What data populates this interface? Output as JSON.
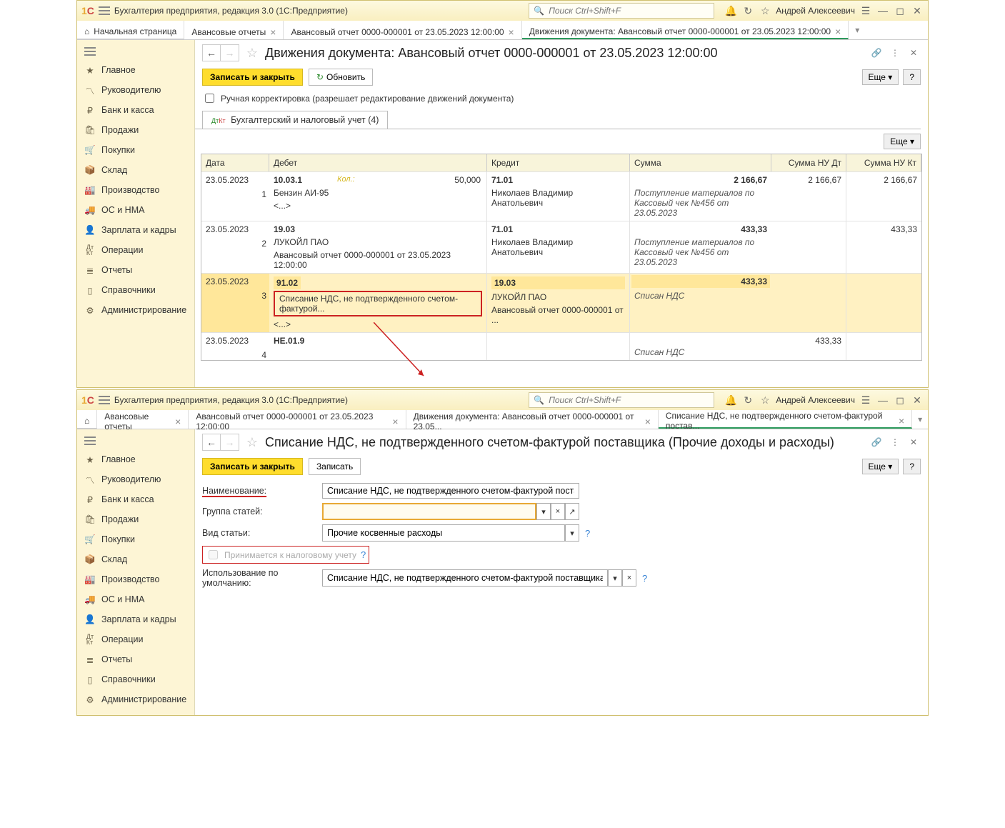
{
  "app_title": "Бухгалтерия предприятия, редакция 3.0  (1С:Предприятие)",
  "search_placeholder": "Поиск Ctrl+Shift+F",
  "user_name": "Андрей Алексеевич",
  "sidebar": [
    {
      "label": "Главное"
    },
    {
      "label": "Руководителю"
    },
    {
      "label": "Банк и касса"
    },
    {
      "label": "Продажи"
    },
    {
      "label": "Покупки"
    },
    {
      "label": "Склад"
    },
    {
      "label": "Производство"
    },
    {
      "label": "ОС и НМА"
    },
    {
      "label": "Зарплата и кадры"
    },
    {
      "label": "Операции"
    },
    {
      "label": "Отчеты"
    },
    {
      "label": "Справочники"
    },
    {
      "label": "Администрирование"
    }
  ],
  "top_window": {
    "tabs": {
      "home": "Начальная страница",
      "t1": "Авансовые отчеты",
      "t2": "Авансовый отчет 0000-000001 от 23.05.2023 12:00:00",
      "t3": "Движения документа: Авансовый отчет 0000-000001 от 23.05.2023 12:00:00"
    },
    "page_title": "Движения документа: Авансовый отчет 0000-000001 от 23.05.2023 12:00:00",
    "save_close": "Записать и закрыть",
    "refresh": "Обновить",
    "more": "Еще",
    "help": "?",
    "manual_corr": "Ручная корректировка (разрешает редактирование движений документа)",
    "doc_tab": "Бухгалтерский и налоговый учет (4)",
    "columns": {
      "date": "Дата",
      "debit": "Дебет",
      "credit": "Кредит",
      "sum": "Сумма",
      "nud": "Сумма НУ Дт",
      "nuk": "Сумма НУ Кт"
    },
    "rows": [
      {
        "n": "1",
        "date": "23.05.2023",
        "debit_acc": "10.03.1",
        "kol_lbl": "Кол.:",
        "kol_val": "50,000",
        "debit_l2": "Бензин АИ-95",
        "debit_l3": "<...>",
        "credit_acc": "71.01",
        "credit_l2": "Николаев Владимир Анатольевич",
        "sum": "2 166,67",
        "desc1": "Поступление материалов по",
        "desc2": "Кассовый чек №456 от",
        "desc3": "23.05.2023",
        "nud": "2 166,67",
        "nuk": "2 166,67"
      },
      {
        "n": "2",
        "date": "23.05.2023",
        "debit_acc": "19.03",
        "debit_l2": "ЛУКОЙЛ ПАО",
        "debit_l3": "Авансовый отчет 0000-000001 от 23.05.2023 12:00:00",
        "credit_acc": "71.01",
        "credit_l2": "Николаев Владимир Анатольевич",
        "sum": "433,33",
        "desc1": "Поступление материалов по",
        "desc2": "Кассовый чек №456 от",
        "desc3": "23.05.2023",
        "nud": "",
        "nuk": "433,33"
      },
      {
        "n": "3",
        "date": "23.05.2023",
        "debit_acc": "91.02",
        "debit_l2": "Списание НДС, не подтвержденного счетом-фактурой...",
        "debit_l3": "<...>",
        "credit_acc": "19.03",
        "credit_l2": "ЛУКОЙЛ ПАО",
        "credit_l3": "Авансовый отчет 0000-000001 от ...",
        "sum": "433,33",
        "desc": "Списан НДС",
        "nud": "",
        "nuk": ""
      },
      {
        "n": "4",
        "date": "23.05.2023",
        "debit_acc": "НЕ.01.9",
        "sum": "",
        "desc": "Списан НДС",
        "nud": "433,33",
        "nuk": ""
      }
    ]
  },
  "bottom_window": {
    "tabs": {
      "t1": "Авансовые отчеты",
      "t2": "Авансовый отчет 0000-000001 от 23.05.2023 12:00:00",
      "t3": "Движения документа: Авансовый отчет 0000-000001 от 23.05...",
      "t4": "Списание НДС, не подтвержденного счетом-фактурой постав..."
    },
    "page_title": "Списание НДС, не подтвержденного счетом-фактурой поставщика (Прочие доходы и расходы)",
    "save_close": "Записать и закрыть",
    "save": "Записать",
    "more": "Еще",
    "help": "?",
    "labels": {
      "name": "Наименование:",
      "group": "Группа статей:",
      "kind": "Вид статьи:",
      "tax": "Принимается к налоговому учету",
      "default": "Использование по умолчанию:"
    },
    "values": {
      "name": "Списание НДС, не подтвержденного счетом-фактурой поставщика",
      "group": "",
      "kind": "Прочие косвенные расходы",
      "default": "Списание НДС, не подтвержденного счетом-фактурой поставщика"
    }
  }
}
